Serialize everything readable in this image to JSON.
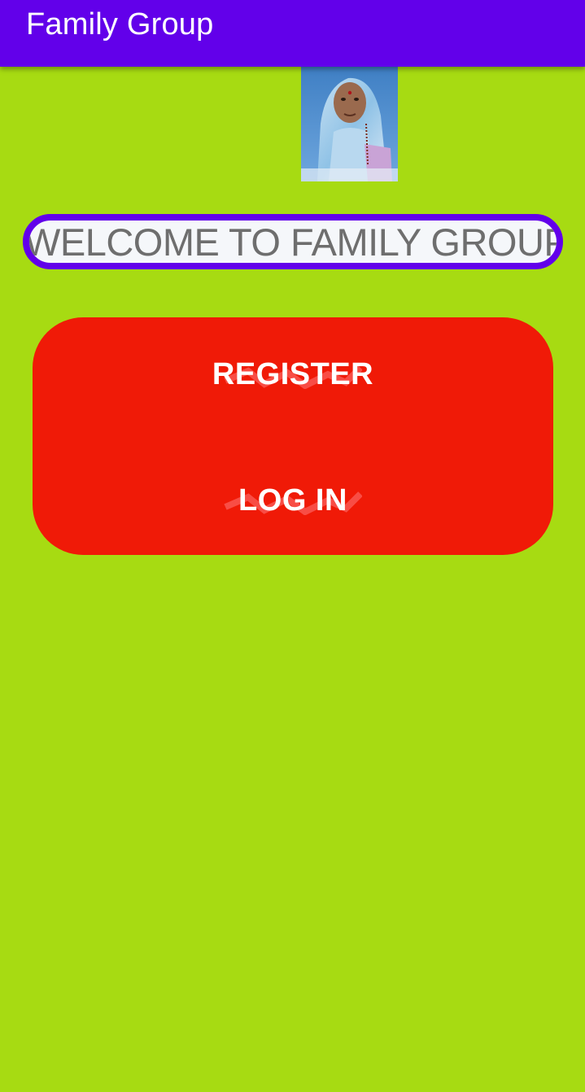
{
  "app_bar": {
    "title": "Family Group",
    "color": "#6200ea"
  },
  "profile_photo": {
    "alt": "profile photo"
  },
  "welcome": {
    "text": "WELCOME TO FAMILY GROUP",
    "border_color": "#6200ea"
  },
  "buttons": {
    "register_label": "REGISTER",
    "login_label": "LOG IN",
    "color": "#f01a07"
  },
  "colors": {
    "background": "#a7db12",
    "text_field_bg": "#f5f7fa"
  }
}
